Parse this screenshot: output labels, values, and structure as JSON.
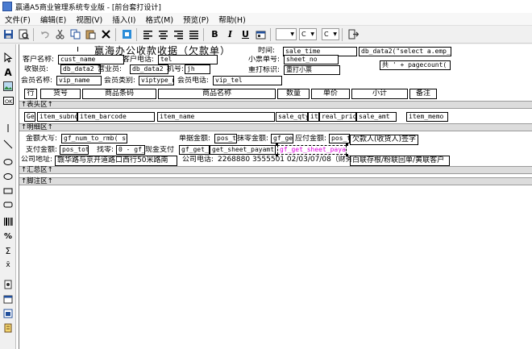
{
  "window": {
    "title": "赢通A5商业管理系统专业版 - [前台套打设计]"
  },
  "menu": [
    "文件(F)",
    "编辑(E)",
    "视图(V)",
    "插入(I)",
    "格式(M)",
    "预览(P)",
    "帮助(H)"
  ],
  "toolbar": {
    "buttons": [
      "save-icon",
      "print-preview-icon",
      "undo-icon",
      "cut-icon",
      "copy-icon",
      "paste-icon",
      "delete-icon",
      "select-all-icon",
      "align-left-icon",
      "align-center-icon",
      "align-right-icon",
      "align-justify-icon",
      "bold-icon",
      "italic-icon",
      "underline-icon",
      "properties-icon"
    ],
    "bold_label": "B",
    "italic_label": "I",
    "underline_label": "U",
    "combo1_value": "",
    "combo2_value": "C",
    "combo3_value": "C"
  },
  "report": {
    "title": "赢海办公收款收据（欠款单）",
    "header_fields": {
      "time_label": "时间:",
      "time_value": "sale_time",
      "query_value": "db_data2(\"select a.emp_na",
      "customer_label": "客户名称:",
      "customer_value": "cust_name",
      "cust_phone_label": "客户电话:",
      "cust_phone_value": "tel",
      "ticket_no_label": "小票单号:",
      "ticket_no_value": "sheet_no",
      "page_count": "共 ' + pagecount(",
      "cashier_label": "收银员:",
      "cashier_value": "db_data2",
      "sales_label": "营业员:",
      "sales_value": "db_data2",
      "machine_label": "机号:",
      "machine_value": "jh",
      "reprint_label": "重打标识:",
      "reprint_value": "重打小票",
      "member_label": "会员名称:",
      "member_value": "vip_name",
      "member_type_label": "会员类别:",
      "member_type_value": "viptype_n",
      "member_phone_label": "会员电话:",
      "member_phone_value": "vip_tel"
    },
    "columns": [
      "行",
      "货号",
      "商品条码",
      "商品名称",
      "数量",
      "单价",
      "小计",
      "备注"
    ],
    "band_header": "↑表头区↑",
    "detail_fields": [
      "Ge",
      "item_subno",
      "item_barcode",
      "item_name",
      "sale_qty",
      "ite",
      "real_price",
      "sale_amt",
      "item_memo"
    ],
    "band_detail": "↑明细区↑",
    "footer_fields": {
      "amount_upper_label": "金额大写:",
      "amount_upper_value": "gf_num_to_rmb( su",
      "single_amount_label": "单据金额:",
      "single_amount_value": "pos_t",
      "discount_label": "抹零金额:",
      "discount_value": "gf_get",
      "payable_label": "应付金额:",
      "payable_value": "pos_t",
      "signature_label": "欠款人(收货人)签字",
      "paid_label": "支付金额:",
      "paid_value": "pos_tot",
      "change_label": "找零:",
      "change_value": "0 - gf_",
      "cash_label": "现金支付",
      "cash_value": "gf_get_",
      "sheet_pay_value": "get_sheet_payamt(t",
      "sheet_pay_selected": "gf_get_sheet_payamt",
      "address_label": "公司地址:",
      "address_value": "赣华路与京开道路口西行50米路南",
      "company_phone_label": "公司电话:",
      "company_phone_value": "2268880 3555501 02/03/07/08（财务）",
      "copies_value": "白联存根/粉联回单/黄联客户"
    },
    "band_summary": "↑汇总区↑",
    "band_footer": "↑脚注区↑"
  }
}
